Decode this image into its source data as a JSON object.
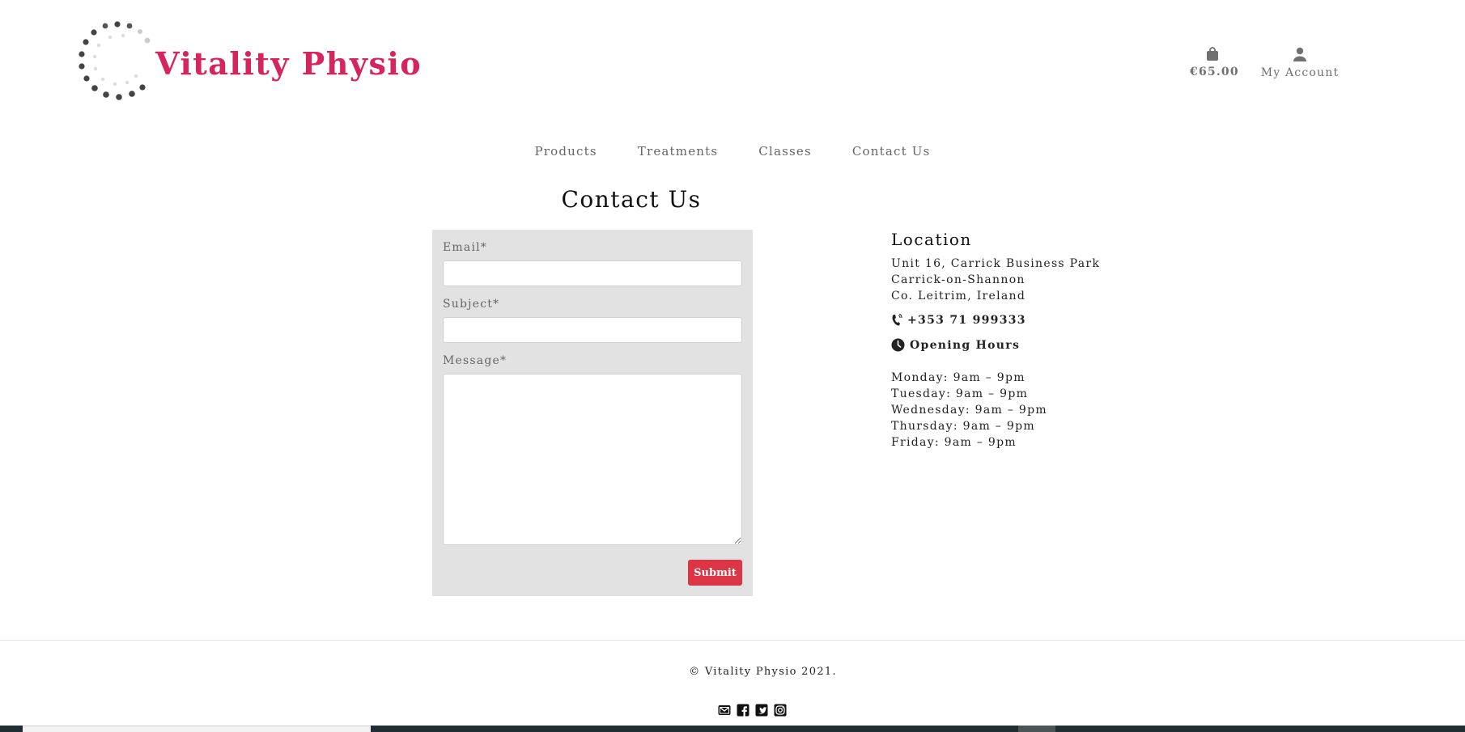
{
  "brand": {
    "name": "Vitality Physio",
    "color": "#d6245c"
  },
  "header": {
    "bag_total": "€65.00",
    "account_label": "My Account"
  },
  "nav": {
    "items": [
      "Products",
      "Treatments",
      "Classes",
      "Contact Us"
    ]
  },
  "page": {
    "title": "Contact Us"
  },
  "form": {
    "email_label": "Email*",
    "email_value": "",
    "subject_label": "Subject*",
    "subject_value": "",
    "message_label": "Message*",
    "message_value": "",
    "submit_label": "Submit",
    "submit_color": "#dc3545"
  },
  "location": {
    "heading": "Location",
    "address": [
      "Unit 16, Carrick Business Park",
      "Carrick-on-Shannon",
      "Co. Leitrim, Ireland"
    ],
    "phone": "+353 71 999333",
    "hours_heading": "Opening Hours",
    "hours": [
      "Monday: 9am – 9pm",
      "Tuesday: 9am – 9pm",
      "Wednesday: 9am – 9pm",
      "Thursday: 9am – 9pm",
      "Friday: 9am – 9pm"
    ]
  },
  "footer": {
    "copyright": "© Vitality Physio 2021.",
    "socials": [
      "email-icon",
      "facebook-icon",
      "twitter-icon",
      "instagram-icon"
    ]
  }
}
